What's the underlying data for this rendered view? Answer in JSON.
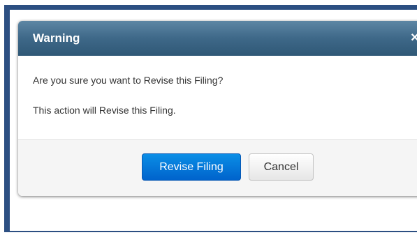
{
  "dialog": {
    "title": "Warning",
    "close_symbol": "×",
    "message": "Are you sure you want to Revise this Filing?",
    "detail": "This action will Revise this Filing.",
    "primary_button_label": "Revise Filing",
    "cancel_button_label": "Cancel"
  },
  "icons": {
    "close": "close-icon"
  },
  "colors": {
    "page_frame": "#2c4f82",
    "header_top": "#5d86a4",
    "header_bottom": "#2f5876",
    "primary_button": "#0a7fdd",
    "footer_background": "#f5f5f5"
  }
}
